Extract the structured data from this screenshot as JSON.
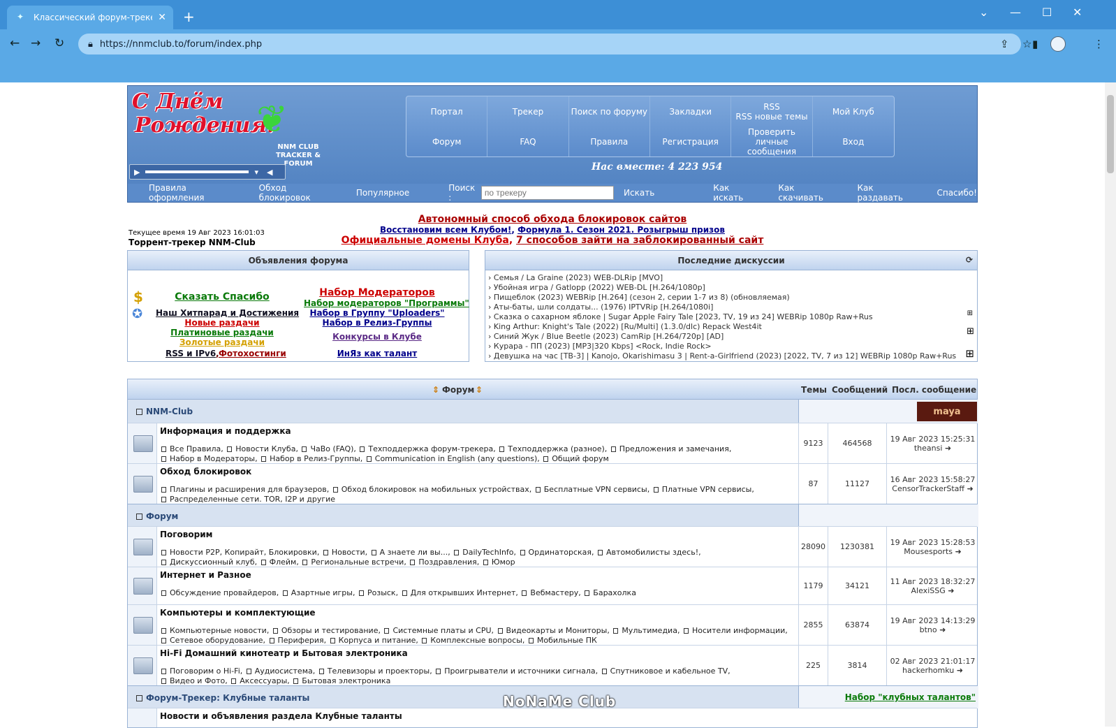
{
  "browser": {
    "tab_title": "Классический форум-трекер ::",
    "url": "https://nnmclub.to/forum/index.php"
  },
  "header": {
    "logo_lines": [
      "С Днём",
      "Рождения!"
    ],
    "club_lines": [
      "NNM CLUB",
      "TRACKER & FORUM"
    ],
    "menu": [
      "Портал",
      "Трекер",
      "Поиск по форуму",
      "Закладки",
      "RSS\nRSS новые темы",
      "Мой Клуб",
      "Форум",
      "FAQ",
      "Правила",
      "Регистрация",
      "Проверить личные сообщения",
      "Вход"
    ],
    "together": "Нас вместе: 4 223 954",
    "sub_left": [
      "Правила оформления",
      "Обход блокировок",
      "Популярное"
    ],
    "search_label": "Поиск :",
    "search_placeholder": "по трекеру",
    "search_button": "Искать",
    "sub_right": [
      "Как искать",
      "Как скачивать",
      "Как раздавать",
      "Спасибо!"
    ]
  },
  "notice": {
    "line1": "Автономный способ обхода блокировок сайтов",
    "line2a": "Восстановим всем Клубом!",
    "line2b": "Формула 1. Сезон 2021. Розыгрыш призов",
    "line3a": "Официальные домены Клуба",
    "line3b": "7 способов зайти на заблокированный сайт"
  },
  "time_info": "Текущее время 19 Авг 2023 16:01:03",
  "site_name": "Торрент-трекер NNM-Club",
  "announcements": {
    "title": "Объявления форума",
    "left": [
      "Сказать Спасибо",
      "Наш Хитпарад и Достижения",
      "Новые раздачи",
      "Платиновые раздачи",
      "Золотые раздачи",
      "RSS и IPv6",
      "Фотохостинги"
    ],
    "right": [
      "Набор Модераторов",
      "Набор модераторов \"Программы\"",
      "Набор в Группу \"Uploaders\"",
      "Набор в Релиз-Группы",
      "Конкурсы в Клубе",
      "ИнЯз как талант"
    ]
  },
  "discussions": {
    "title": "Последние дискуссии",
    "items": [
      "Семья / La Graine (2023) WEB-DLRip [MVO]",
      "Убойная игра / Gatlopp (2022) WEB-DL [H.264/1080p]",
      "Пищеблок (2023) WEBRip [H.264] (сезон 2, серии 1-7 из 8) (обновляемая)",
      "Аты-баты, шли солдаты... (1976) IPTVRip [H.264/1080i]",
      "Сказка о сахарном яблоке | Sugar Apple Fairy Tale [2023, TV, 19 из 24] WEBRip 1080p Raw+Rus",
      "King Arthur: Knight's Tale (2022) [Ru/Multi] (1.3.0/dlc) Repack West4it",
      "Синий Жук / Blue Beetle (2023) CamRip [H.264/720p] [AD]",
      "Курара - ПП (2023) [MP3|320 Kbps] <Rock, Indie Rock>",
      "Девушка на час [ТВ-3] | Kanojo, Okarishimasu 3 | Rent-a-Girlfriend (2023) [2022, TV, 7 из 12] WEBRip 1080p Raw+Rus"
    ]
  },
  "forum_table": {
    "headers": {
      "forum": "Форум",
      "topics": "Темы",
      "posts": "Сообщений",
      "last": "Посл. сообщение"
    },
    "badge": "maya",
    "cats": [
      "NNM-Club",
      "Форум",
      "Форум-Трекер: Клубные таланты"
    ],
    "cat3_link": "Набор \"клубных талантов\"",
    "rows": [
      {
        "title": "Информация и поддержка",
        "l1": [
          "Все Правила",
          "Новости Клуба",
          "ЧаВо (FAQ)",
          "Техподдержка форум-трекера",
          "Техподдержка (разное)",
          "Предложения и замечания"
        ],
        "l2": [
          "Набор в Модераторы",
          "Набор в Релиз-Группы",
          "Communication in English (any questions)",
          "Общий форум"
        ],
        "topics": "9123",
        "posts": "464568",
        "date": "19 Авг 2023 15:25:31",
        "user": "theansi"
      },
      {
        "title": "Обход блокировок",
        "l1": [
          "Плагины и расширения для браузеров",
          "Обход блокировок на мобильных устройствах",
          "Бесплатные VPN сервисы",
          "Платные VPN сервисы"
        ],
        "l2": [
          "Распределенные сети. TOR, I2P и другие"
        ],
        "topics": "87",
        "posts": "11127",
        "date": "16 Авг 2023 15:58:27",
        "user": "CensorTrackerStaff"
      },
      {
        "title": "Поговорим",
        "l1": [
          "Новости P2P, Копирайт, Блокировки",
          "Новости",
          "А знаете ли вы...",
          "DailyTechInfo",
          "Ординаторская",
          "Автомобилисты здесь!"
        ],
        "l2": [
          "Дискуссионный клуб",
          "Флейм",
          "Региональные встречи",
          "Поздравления",
          "Юмор"
        ],
        "topics": "28090",
        "posts": "1230381",
        "date": "19 Авг 2023 15:28:53",
        "user": "Mousesports"
      },
      {
        "title": "Интернет и Разное",
        "l1": [
          "Обсуждение провайдеров",
          "Азартные игры",
          "Розыск",
          "Для открывших Интернет",
          "Вебмастеру",
          "Барахолка"
        ],
        "l2": [],
        "topics": "1179",
        "posts": "34121",
        "date": "11 Авг 2023 18:32:27",
        "user": "AlexiSSG"
      },
      {
        "title": "Компьютеры и комплектующие",
        "l1": [
          "Компьютерные новости",
          "Обзоры и тестирование",
          "Системные платы и CPU",
          "Видеокарты и Мониторы",
          "Мультимедиа",
          "Носители информации"
        ],
        "l2": [
          "Сетевое оборудование",
          "Периферия",
          "Корпуса и питание",
          "Комплексные вопросы",
          "Мобильные ПК"
        ],
        "topics": "2855",
        "posts": "63874",
        "date": "19 Авг 2023 14:13:29",
        "user": "btno"
      },
      {
        "title": "Hi-Fi Домашний кинотеатр и Бытовая электроника",
        "l1": [
          "Поговорим о Hi-Fi",
          "Аудиосистема",
          "Телевизоры и проекторы",
          "Проигрыватели и источники сигнала",
          "Спутниковое и кабельное TV"
        ],
        "l2": [
          "Видео и Фото",
          "Аксессуары",
          "Бытовая электроника"
        ],
        "topics": "225",
        "posts": "3814",
        "date": "02 Авг 2023 21:01:17",
        "user": "hackerhomku"
      },
      {
        "title": "Новости и объявления раздела Клубные таланты",
        "l1": [],
        "l2": [],
        "topics": "",
        "posts": "",
        "date": "",
        "user": ""
      }
    ]
  },
  "watermark": "NoNaMe Club",
  "colors": {
    "header_blue": "#5b8bca",
    "link_green": "#0a7a0a",
    "link_red": "#cc0000"
  }
}
